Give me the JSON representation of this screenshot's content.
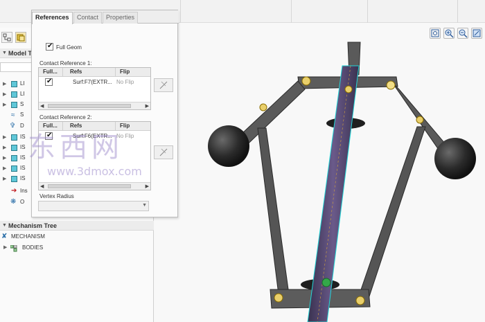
{
  "dialog": {
    "tabs": [
      "References",
      "Contact",
      "Properties"
    ],
    "full_geom_label": "Full Geom",
    "contact_ref1_label": "Contact Reference 1:",
    "contact_ref2_label": "Contact Reference 2:",
    "columns": [
      "Full...",
      "Refs",
      "Flip"
    ],
    "ref1": {
      "ref": "Surf:F7(EXTR...",
      "flip": "No Flip"
    },
    "ref2": {
      "ref": "Surf:F6(EXTR...",
      "flip": "No Flip"
    },
    "vertex_radius_label": "Vertex Radius"
  },
  "left_panel": {
    "model_tree_header": "Model T",
    "model_items": [
      "LI",
      "LI",
      "S",
      "S",
      "D",
      "IS",
      "IS",
      "IS",
      "IS",
      "IS",
      "Ins",
      "O"
    ],
    "mechanism_tree_header": "Mechanism Tree",
    "mechanism_root": "MECHANISM",
    "bodies": "BODIES"
  },
  "watermark": {
    "big": "东西网",
    "small": "www.3dmox.com"
  },
  "icons": [
    "filter-icon",
    "settings-icon",
    "zoom-fit-icon",
    "zoom-in-icon",
    "zoom-out-icon",
    "repaint-icon"
  ]
}
